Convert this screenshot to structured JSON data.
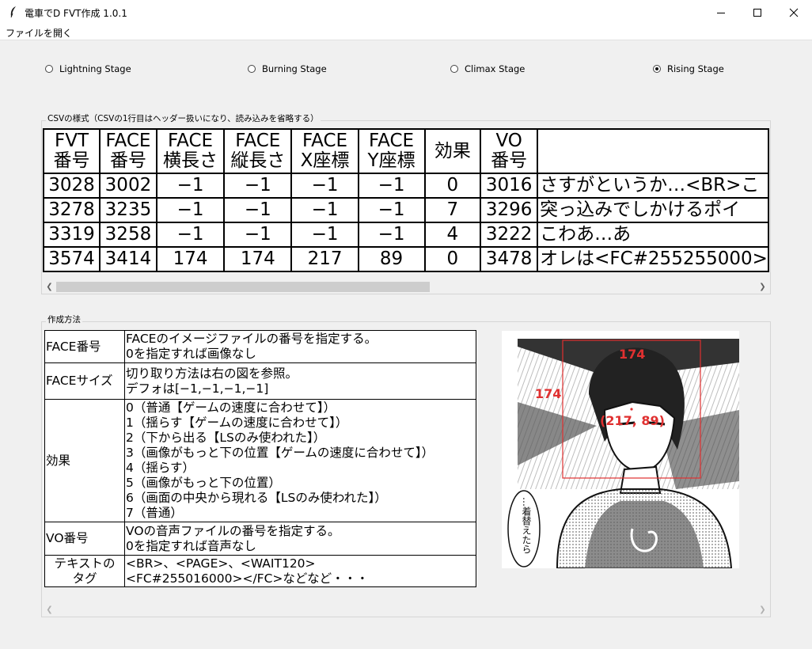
{
  "window": {
    "title": "電車でD FVT作成 1.0.1"
  },
  "menu": {
    "open_file": "ファイルを開く"
  },
  "stages": [
    {
      "label": "Lightning Stage",
      "selected": false
    },
    {
      "label": "Burning Stage",
      "selected": false
    },
    {
      "label": "Climax Stage",
      "selected": false
    },
    {
      "label": "Rising Stage",
      "selected": true
    }
  ],
  "csv_group": {
    "title": "CSVの様式（CSVの1行目はヘッダー扱いになり、読み込みを省略する）",
    "headers": [
      {
        "line1": "FVT",
        "line2": "番号"
      },
      {
        "line1": "FACE",
        "line2": "番号"
      },
      {
        "line1": "FACE",
        "line2": "横長さ"
      },
      {
        "line1": "FACE",
        "line2": "縦長さ"
      },
      {
        "line1": "FACE",
        "line2": "X座標"
      },
      {
        "line1": "FACE",
        "line2": "Y座標"
      },
      {
        "line1": "効果",
        "line2": ""
      },
      {
        "line1": "VO",
        "line2": "番号"
      },
      {
        "line1": "",
        "line2": ""
      }
    ],
    "rows": [
      [
        "3028",
        "3002",
        "−1",
        "−1",
        "−1",
        "−1",
        "0",
        "3016",
        "さすがというか…<BR>こ"
      ],
      [
        "3278",
        "3235",
        "−1",
        "−1",
        "−1",
        "−1",
        "7",
        "3296",
        "突っ込みでしかけるポイ"
      ],
      [
        "3319",
        "3258",
        "−1",
        "−1",
        "−1",
        "−1",
        "4",
        "3222",
        "こわあ…あ"
      ],
      [
        "3574",
        "3414",
        "174",
        "174",
        "217",
        "89",
        "0",
        "3478",
        "オレは<FC#255255000>"
      ]
    ]
  },
  "method_group": {
    "title": "作成方法",
    "rows": [
      {
        "key": "FACE番号",
        "lines": [
          "FACEのイメージファイルの番号を指定する。",
          "0を指定すれば画像なし"
        ]
      },
      {
        "key": "FACEサイズ",
        "lines": [
          "切り取り方法は右の図を参照。",
          "デフォは[−1,−1,−1,−1]"
        ]
      },
      {
        "key": "効果",
        "lines": [
          "0（普通【ゲームの速度に合わせて】）",
          "1（揺らす【ゲームの速度に合わせて】）",
          "2（下から出る【LSのみ使われた】）",
          "3（画像がもっと下の位置【ゲームの速度に合わせて】）",
          "4（揺らす）",
          "5（画像がもっと下の位置）",
          "6（画面の中央から現れる【LSのみ使われた】）",
          "7（普通）"
        ]
      },
      {
        "key": "VO番号",
        "lines": [
          "VOの音声ファイルの番号を指定する。",
          "0を指定すれば音声なし"
        ]
      },
      {
        "key_line1": "テキストの",
        "key_line2": "タグ",
        "lines": [
          "<BR>、<PAGE>、<WAIT120>",
          "<FC#255016000></FC>などなど・・・"
        ]
      }
    ]
  },
  "illustration": {
    "width_label": "174",
    "height_label": "174",
    "coord_label": "(217, 89)",
    "speech_text": "…着替えたら",
    "accent_color": "#e03030"
  }
}
